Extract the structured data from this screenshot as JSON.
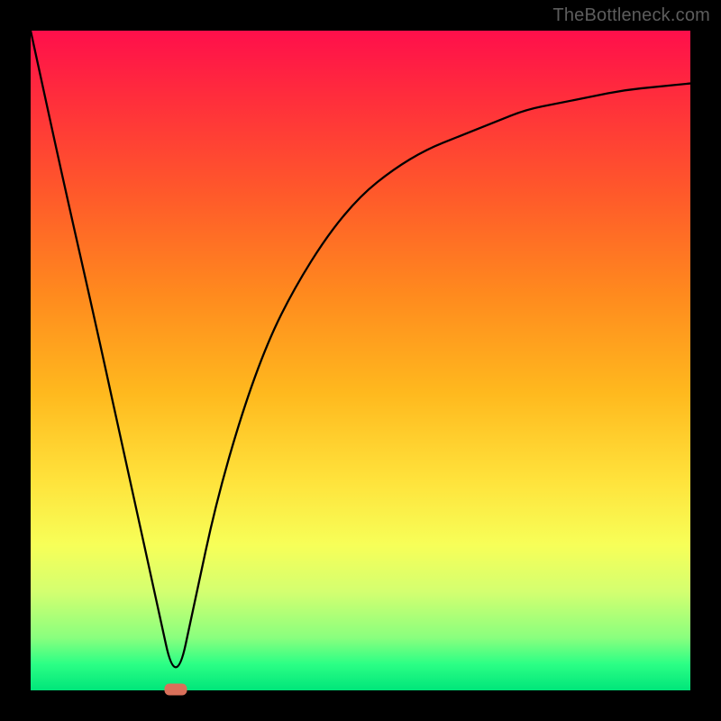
{
  "watermark": "TheBottleneck.com",
  "chart_data": {
    "type": "line",
    "title": "",
    "xlabel": "",
    "ylabel": "",
    "xlim": [
      0,
      100
    ],
    "ylim": [
      0,
      100
    ],
    "x": [
      0,
      5,
      10,
      15,
      19,
      22,
      25,
      28,
      32,
      36,
      40,
      45,
      50,
      55,
      60,
      65,
      70,
      75,
      80,
      85,
      90,
      95,
      100
    ],
    "values": [
      100,
      77,
      55,
      32,
      14,
      0,
      14,
      28,
      42,
      53,
      61,
      69,
      75,
      79,
      82,
      84,
      86,
      88,
      89,
      90,
      91,
      91.5,
      92
    ],
    "marker": {
      "x": 22,
      "y": 0
    },
    "background_gradient": {
      "top": "#ff0f4b",
      "bottom": "#00e57a",
      "stops": [
        "#ff0f4b",
        "#ff2d3c",
        "#ff5a2a",
        "#ff8a1e",
        "#ffb91e",
        "#ffe23b",
        "#f7ff58",
        "#d4ff70",
        "#8aff7e",
        "#2cff85",
        "#00e57a"
      ]
    }
  }
}
